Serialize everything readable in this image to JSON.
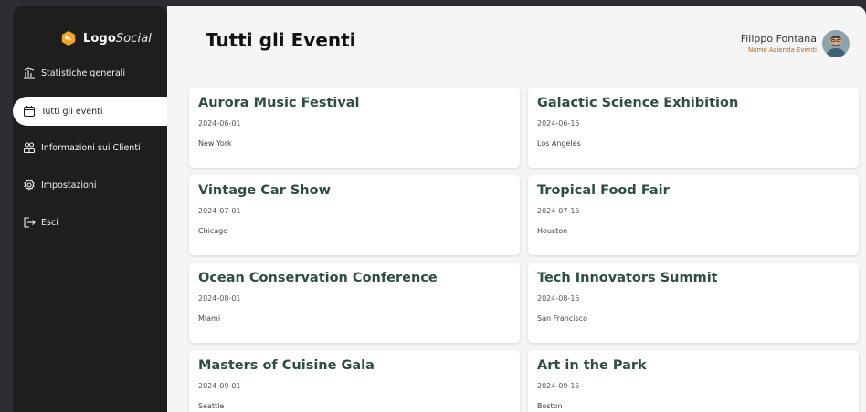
{
  "brand": {
    "name_bold": "Logo",
    "name_light": "Social",
    "accent_color": "#f5a623"
  },
  "sidebar": {
    "items": [
      {
        "label": "Statistiche generali",
        "icon": "chart-icon",
        "active": false
      },
      {
        "label": "Tutti gli eventi",
        "icon": "calendar-icon",
        "active": true
      },
      {
        "label": "Informazioni sui Clienti",
        "icon": "users-icon",
        "active": false
      },
      {
        "label": "Impostazioni",
        "icon": "gear-icon",
        "active": false
      },
      {
        "label": "Esci",
        "icon": "logout-icon",
        "active": false
      }
    ]
  },
  "header": {
    "title": "Tutti gli Eventi",
    "user_name": "Filippo Fontana",
    "company": "Nome Azienda Eventi"
  },
  "events": [
    {
      "title": "Aurora Music Festival",
      "date": "2024-06-01",
      "city": "New York"
    },
    {
      "title": "Galactic Science Exhibition",
      "date": "2024-06-15",
      "city": "Los Angeles"
    },
    {
      "title": "Vintage Car Show",
      "date": "2024-07-01",
      "city": "Chicago"
    },
    {
      "title": "Tropical Food Fair",
      "date": "2024-07-15",
      "city": "Houston"
    },
    {
      "title": "Ocean Conservation Conference",
      "date": "2024-08-01",
      "city": "Miami"
    },
    {
      "title": "Tech Innovators Summit",
      "date": "2024-08-15",
      "city": "San Francisco"
    },
    {
      "title": "Masters of Cuisine Gala",
      "date": "2024-09-01",
      "city": "Seattle"
    },
    {
      "title": "Art in the Park",
      "date": "2024-09-15",
      "city": "Boston"
    }
  ],
  "colors": {
    "sidebar_bg": "#1e1e1e",
    "main_bg": "#f5f5f5",
    "card_title": "#2e4e45",
    "company_text": "#c0651a"
  }
}
